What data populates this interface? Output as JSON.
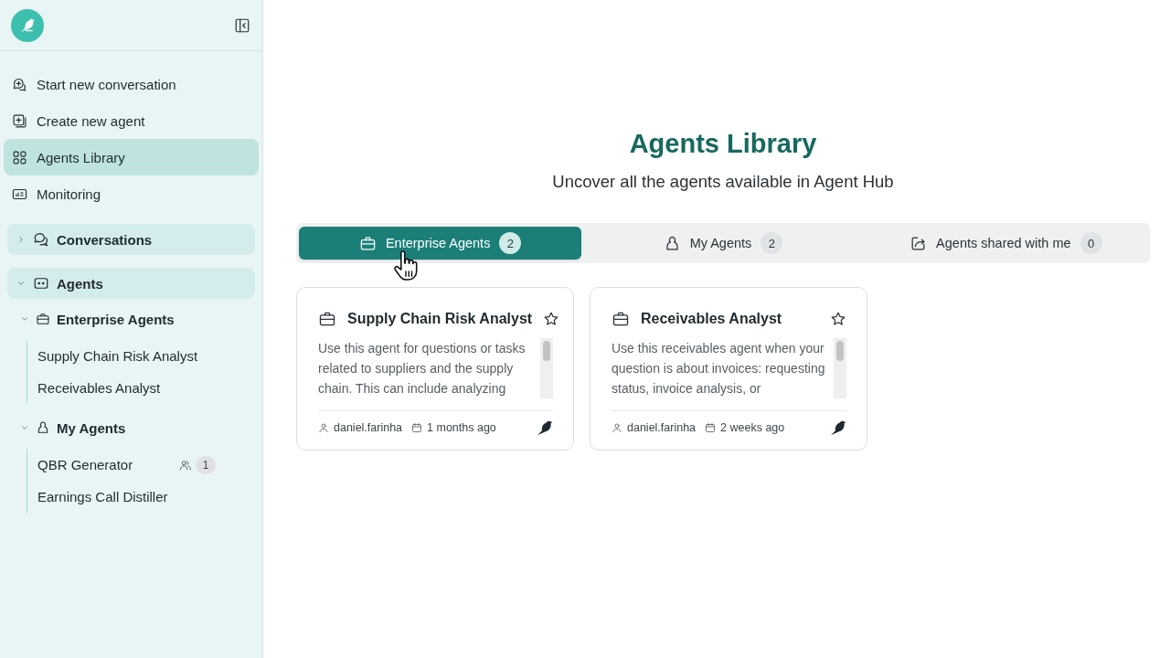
{
  "sidebar": {
    "nav": [
      {
        "label": "Start new conversation",
        "selected": false
      },
      {
        "label": "Create new agent",
        "selected": false
      },
      {
        "label": "Agents Library",
        "selected": true
      },
      {
        "label": "Monitoring",
        "selected": false
      }
    ],
    "sections": [
      {
        "label": "Conversations",
        "expanded": false
      },
      {
        "label": "Agents",
        "expanded": true,
        "children": [
          {
            "label": "Enterprise Agents",
            "expanded": true,
            "children": [
              {
                "label": "Supply Chain Risk Analyst"
              },
              {
                "label": "Receivables Analyst"
              }
            ]
          },
          {
            "label": "My Agents",
            "expanded": true,
            "children": [
              {
                "label": "QBR Generator",
                "shared_count": "1"
              },
              {
                "label": "Earnings Call Distiller"
              }
            ]
          }
        ]
      }
    ]
  },
  "header": {
    "title": "Agents Library",
    "subtitle": "Uncover all the agents available in Agent Hub"
  },
  "tabs": [
    {
      "label": "Enterprise Agents",
      "count": "2",
      "selected": true
    },
    {
      "label": "My Agents",
      "count": "2",
      "selected": false
    },
    {
      "label": "Agents shared with me",
      "count": "0",
      "selected": false
    }
  ],
  "cards": [
    {
      "title": "Supply Chain Risk Analyst",
      "favorite": false,
      "description": "Use this agent for questions or tasks related to suppliers and the supply chain. This can include analyzing",
      "author": "daniel.farinha",
      "age": "1 months ago"
    },
    {
      "title": "Receivables Analyst",
      "favorite": false,
      "description": "Use this receivables agent when your question is about invoices: requesting status, invoice analysis, or",
      "author": "daniel.farinha",
      "age": "2 weeks ago"
    }
  ]
}
